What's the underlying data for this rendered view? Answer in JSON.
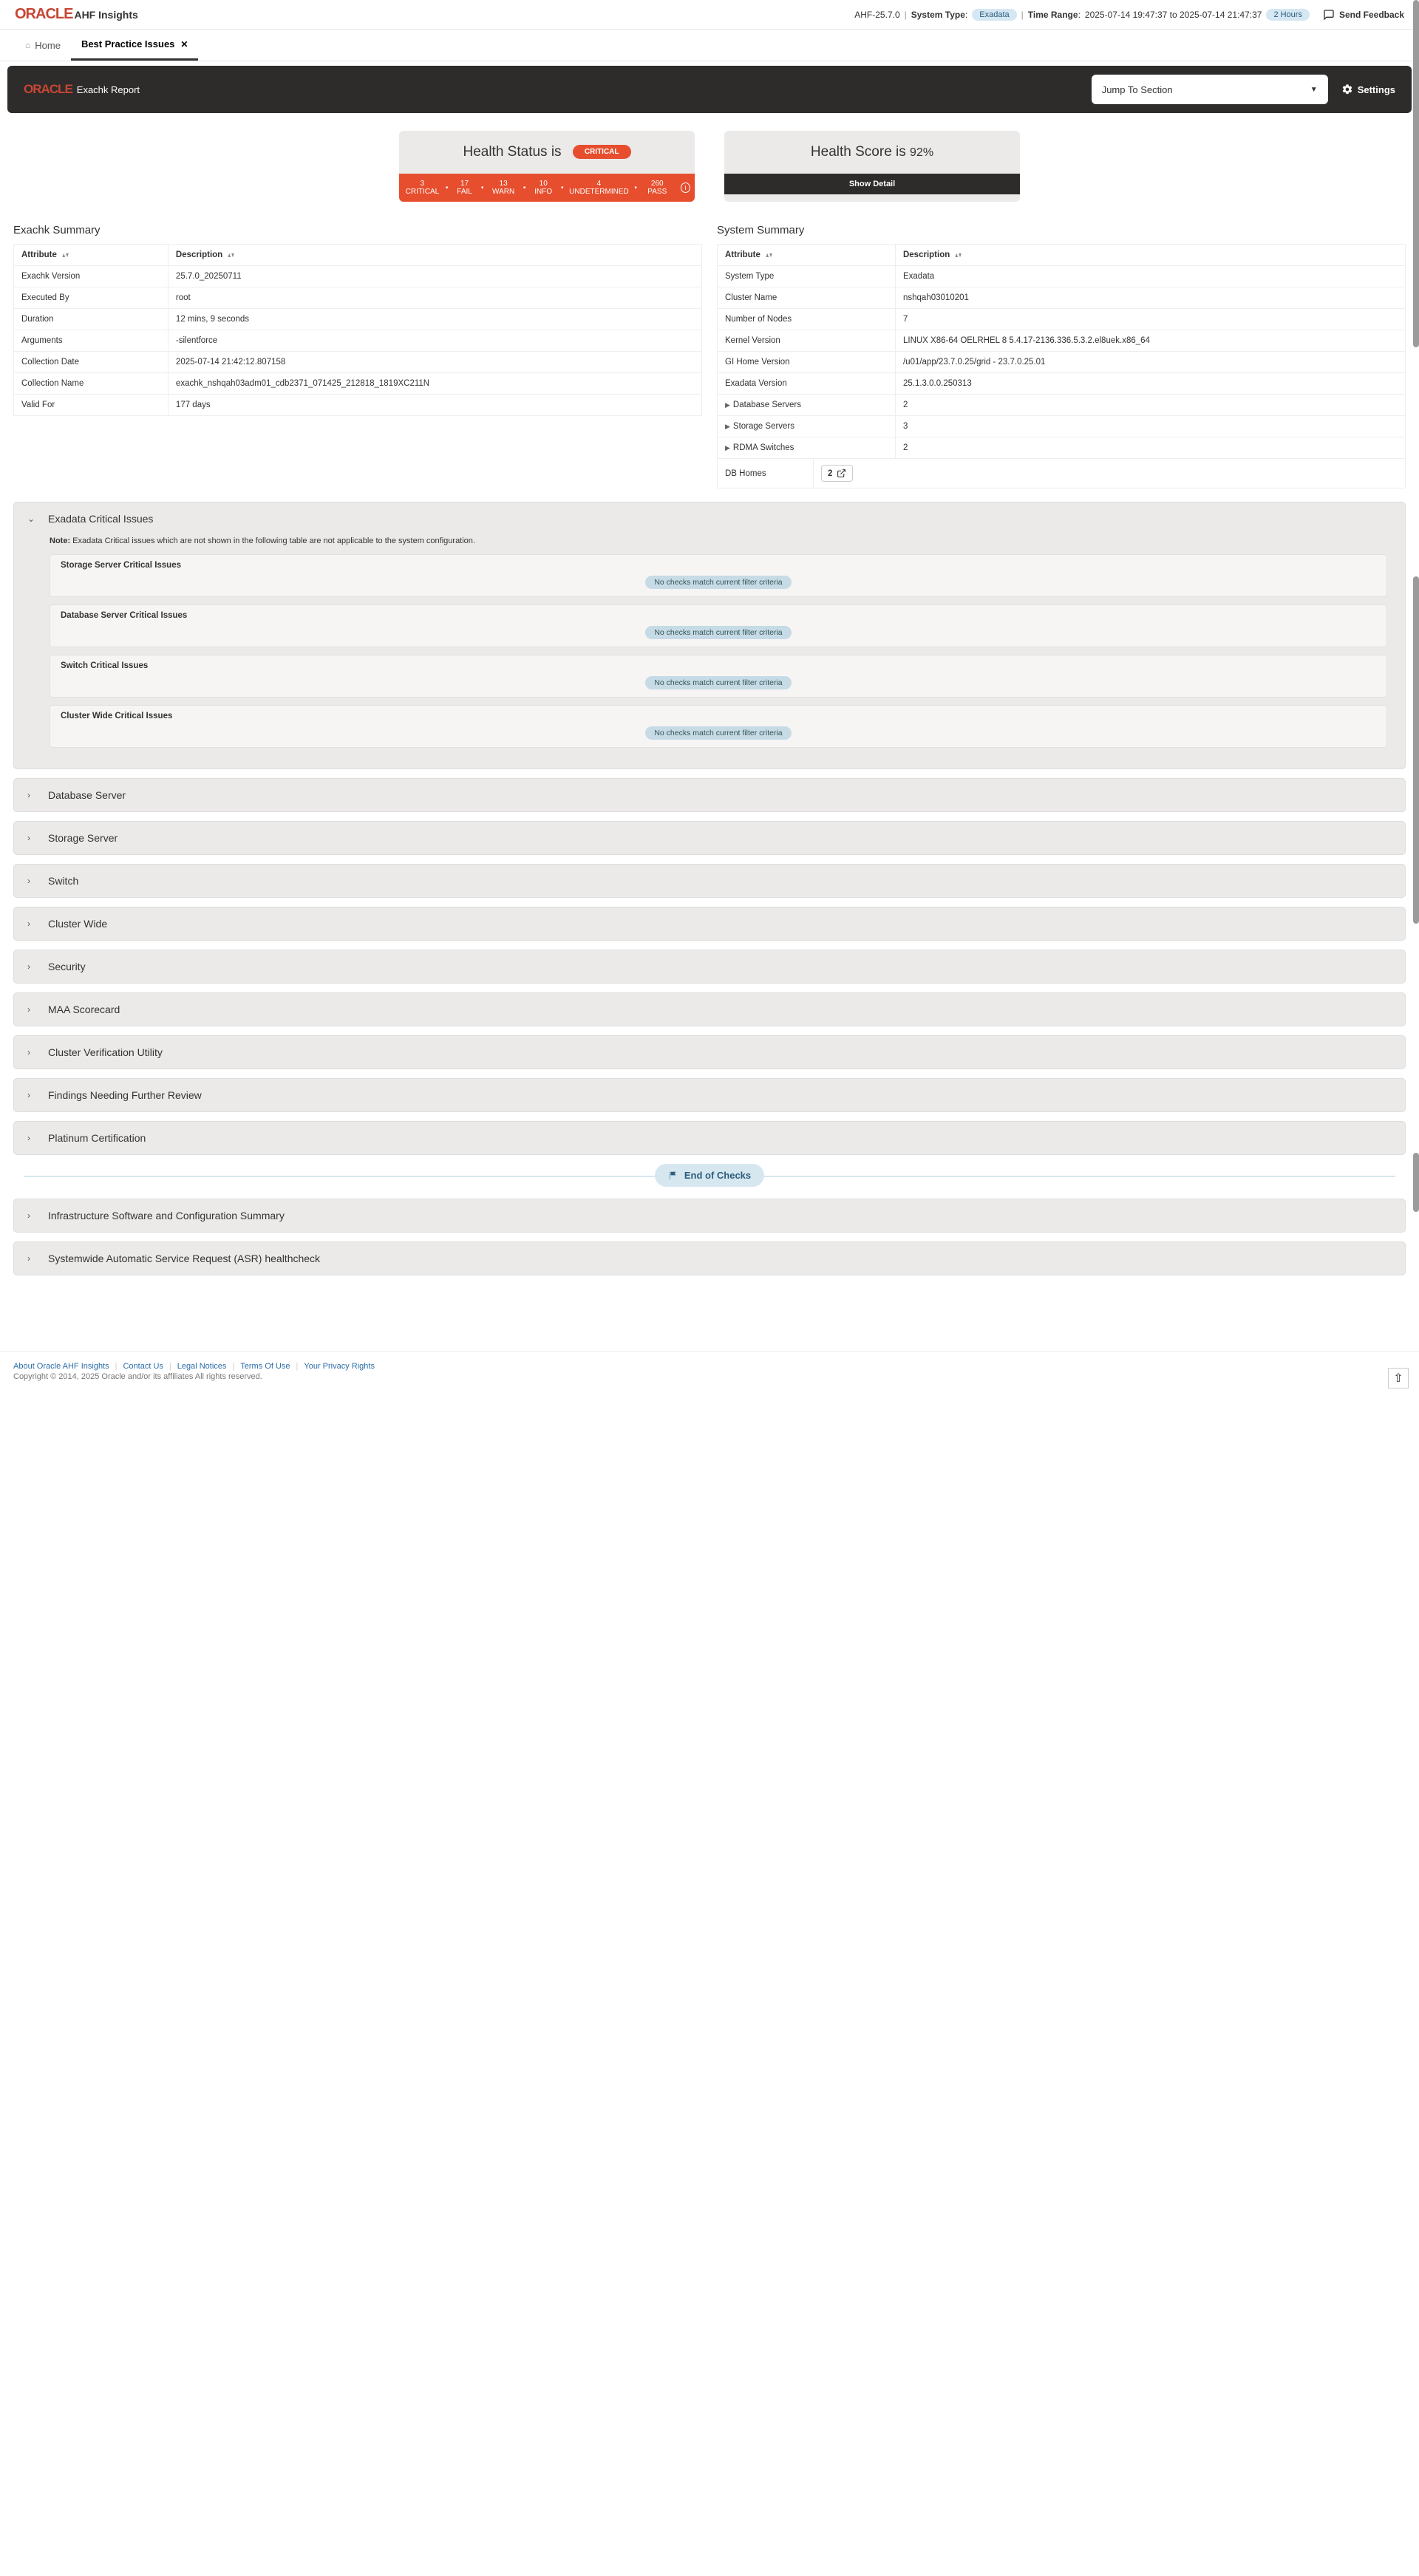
{
  "header": {
    "logo_text": "ORACLE",
    "product": "AHF Insights",
    "version": "AHF-25.7.0",
    "system_type_label": "System Type",
    "system_type_value": "Exadata",
    "time_range_label": "Time Range",
    "time_range_value": "2025-07-14 19:47:37 to 2025-07-14 21:47:37",
    "time_range_chip": "2 Hours",
    "feedback": "Send Feedback"
  },
  "tabs": {
    "home": "Home",
    "bp": "Best Practice Issues"
  },
  "darkbar": {
    "logo_text": "ORACLE",
    "title": "Exachk Report",
    "jump_placeholder": "Jump To Section",
    "settings": "Settings"
  },
  "health_status": {
    "label": "Health Status is",
    "badge": "CRITICAL",
    "strip": {
      "a": "3 CRITICAL",
      "b": "17 FAIL",
      "c": "13 WARN",
      "d": "10 INFO",
      "e": "4 UNDETERMINED",
      "f": "260 PASS"
    }
  },
  "health_score": {
    "label": "Health Score is",
    "value": "92%",
    "button": "Show Detail"
  },
  "exachk_summary": {
    "title": "Exachk Summary",
    "cols": {
      "a": "Attribute",
      "b": "Description"
    },
    "rows": [
      {
        "a": "Exachk Version",
        "b": "25.7.0_20250711"
      },
      {
        "a": "Executed By",
        "b": "root"
      },
      {
        "a": "Duration",
        "b": "12 mins, 9 seconds"
      },
      {
        "a": "Arguments",
        "b": "-silentforce"
      },
      {
        "a": "Collection Date",
        "b": "2025-07-14 21:42:12.807158"
      },
      {
        "a": "Collection Name",
        "b": "exachk_nshqah03adm01_cdb2371_071425_212818_1819XC211N"
      },
      {
        "a": "Valid For",
        "b": "177 days"
      }
    ]
  },
  "system_summary": {
    "title": "System Summary",
    "cols": {
      "a": "Attribute",
      "b": "Description"
    },
    "rows": [
      {
        "a": "System Type",
        "b": "Exadata"
      },
      {
        "a": "Cluster Name",
        "b": "nshqah03010201"
      },
      {
        "a": "Number of Nodes",
        "b": "7"
      },
      {
        "a": "Kernel Version",
        "b": "LINUX X86-64 OELRHEL 8 5.4.17-2136.336.5.3.2.el8uek.x86_64"
      },
      {
        "a": "GI Home Version",
        "b": "/u01/app/23.7.0.25/grid - 23.7.0.25.01"
      },
      {
        "a": "Exadata Version",
        "b": "25.1.3.0.0.250313"
      },
      {
        "a": "Database Servers",
        "b": "2",
        "expand": true
      },
      {
        "a": "Storage Servers",
        "b": "3",
        "expand": true
      },
      {
        "a": "RDMA Switches",
        "b": "2",
        "expand": true
      }
    ],
    "db_homes_label": "DB Homes",
    "db_homes_value": "2"
  },
  "critical_section": {
    "title": "Exadata Critical Issues",
    "note_label": "Note:",
    "note_text": "Exadata Critical issues which are not shown in the following table are not applicable to the system configuration.",
    "no_match": "No checks match current filter criteria",
    "subs": [
      "Storage Server Critical Issues",
      "Database Server Critical Issues",
      "Switch Critical Issues",
      "Cluster Wide Critical Issues"
    ]
  },
  "panels": [
    "Database Server",
    "Storage Server",
    "Switch",
    "Cluster Wide",
    "Security",
    "MAA Scorecard",
    "Cluster Verification Utility",
    "Findings Needing Further Review",
    "Platinum Certification"
  ],
  "end_checks": "End of Checks",
  "panels2": [
    "Infrastructure Software and Configuration Summary",
    "Systemwide Automatic Service Request (ASR) healthcheck"
  ],
  "footer": {
    "links": [
      "About Oracle AHF Insights",
      "Contact Us",
      "Legal Notices",
      "Terms Of Use",
      "Your Privacy Rights"
    ],
    "copyright": "Copyright © 2014, 2025 Oracle and/or its affiliates All rights reserved."
  }
}
